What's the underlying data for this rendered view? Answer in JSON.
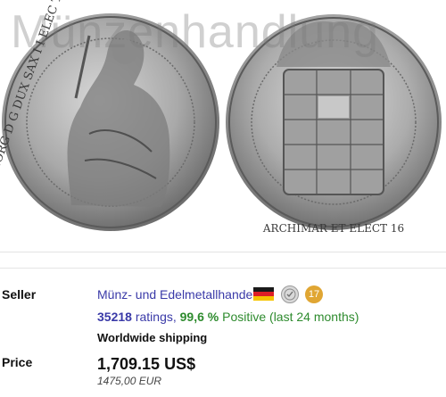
{
  "image": {
    "watermark": "Münzenhandlung",
    "left_coin": {
      "legend": "IOHAN GEORG D G DUX SAX I I ELEC TMONT"
    },
    "right_coin": {
      "legend": "ARCHIMAR ET ELECT 16"
    }
  },
  "seller": {
    "label": "Seller",
    "name": "Münz- und Edelmetallhandel",
    "flag_colors": [
      "#1a1a1a",
      "#dd1f26",
      "#f6c500"
    ],
    "award_icon": "verified-seal-icon",
    "badge_count": "17",
    "rating_count": "35218",
    "rating_word": "ratings,",
    "positive_pct": "99,6 %",
    "positive_text": "Positive (last 24 months)",
    "shipping": "Worldwide shipping"
  },
  "price": {
    "label": "Price",
    "usd": "1,709.15 US$",
    "eur": "1475,00 EUR"
  }
}
